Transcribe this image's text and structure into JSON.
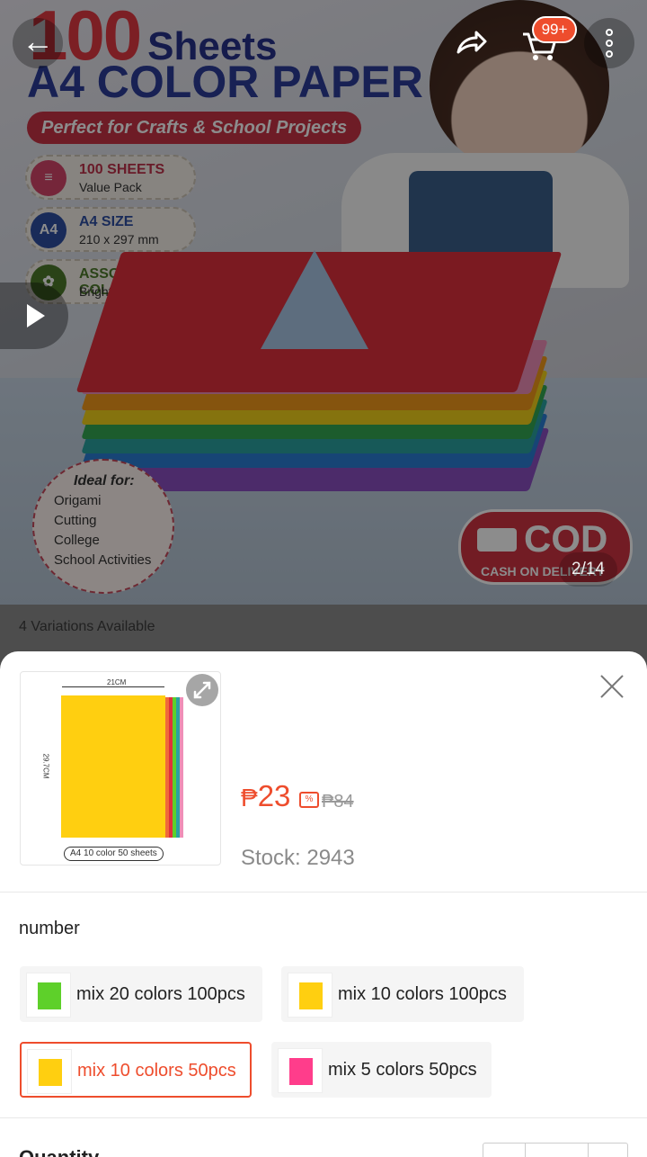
{
  "hero": {
    "title_number": "100",
    "title_word": "Sheets",
    "subtitle": "A4 COLOR PAPER",
    "tagline": "Perfect for Crafts & School Projects",
    "features": [
      {
        "badge": "",
        "title": "100 SHEETS",
        "sub": "Value Pack",
        "color": "#d6456a"
      },
      {
        "badge": "A4",
        "title": "A4 SIZE",
        "sub": "210 x 297 mm",
        "color": "#2f4fa3"
      },
      {
        "badge": "",
        "title": "ASSORTED COLORS",
        "sub": "Bright & Vibrant",
        "color": "#4d7a2a"
      }
    ],
    "ideal_title": "Ideal for:",
    "ideal_items": [
      "Origami",
      "Cutting",
      "College",
      "School Activities"
    ],
    "cod_big": "COD",
    "cod_small": "CASH ON DELIVERY",
    "page_indicator": "2/14"
  },
  "nav": {
    "back_icon": "←",
    "cart_badge": "99+",
    "more_icon": "•\n•\n•"
  },
  "variations_available": "4 Variations Available",
  "product": {
    "thumb_width_label": "21CM",
    "thumb_height_label": "29.7CM",
    "thumb_caption": "A4 10 color 50 sheets",
    "currency": "₱",
    "price": "23",
    "original_price": "₱84",
    "stock": "Stock: 2943"
  },
  "options": {
    "section_label": "number",
    "items": [
      {
        "label": "mix 20 colors 100pcs",
        "swatch": "#5ed02a",
        "selected": false
      },
      {
        "label": "mix 10 colors 100pcs",
        "swatch": "#ffcf10",
        "selected": false
      },
      {
        "label": "mix 10 colors 50pcs",
        "swatch": "#ffcf10",
        "selected": true
      },
      {
        "label": "mix 5 colors 50pcs",
        "swatch": "#ff3d8b",
        "selected": false
      }
    ]
  },
  "quantity_label": "Quantity",
  "colors": {
    "accent": "#ee4d2d",
    "muted_text": "#8a8a8a"
  }
}
